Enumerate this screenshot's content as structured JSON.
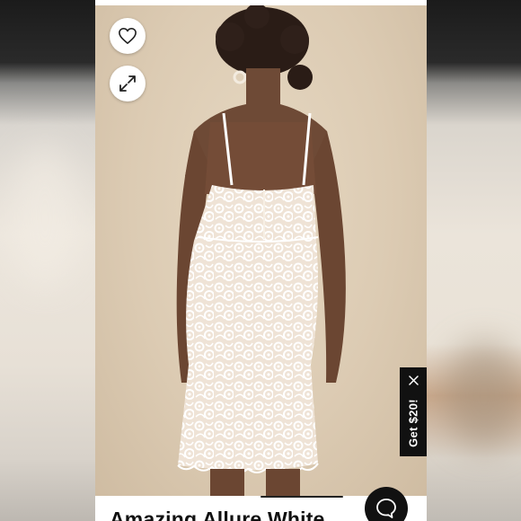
{
  "product": {
    "title": "Amazing Allure White"
  },
  "actions": {
    "favorite_icon": "heart-icon",
    "expand_icon": "expand-icon",
    "chat_icon": "chat-bubble-icon"
  },
  "promo": {
    "label": "Get $20!",
    "close_icon": "close-icon"
  },
  "colors": {
    "photo_background": "#dccbb3",
    "dress": "#f7f4ef",
    "promo_background": "#111111",
    "chat_background": "#111111"
  }
}
